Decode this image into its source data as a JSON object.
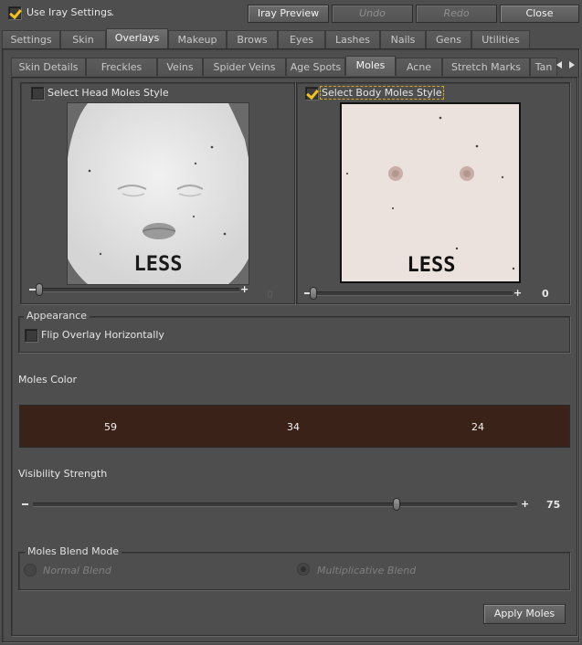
{
  "top_bar": {
    "use_iray_label": "Use Iray Settings",
    "ellipsis": "..",
    "iray_preview": "Iray Preview",
    "undo": "Undo",
    "redo": "Redo",
    "close": "Close"
  },
  "main_tabs": [
    "Settings",
    "Skin",
    "Overlays",
    "Makeup",
    "Brows",
    "Eyes",
    "Lashes",
    "Nails",
    "Gens",
    "Utilities"
  ],
  "sub_tabs": [
    "Skin Details",
    "Freckles",
    "Veins",
    "Spider Veins",
    "Age Spots",
    "Moles",
    "Acne",
    "Stretch Marks",
    "Tan"
  ],
  "head_moles": {
    "label": "Select Head Moles Style",
    "preview_text": "LESS",
    "slider_value": "0"
  },
  "body_moles": {
    "label": "Select Body Moles Style",
    "preview_text": "LESS",
    "slider_value": "0"
  },
  "appearance": {
    "title": "Appearance",
    "flip_label": "Flip Overlay Horizontally"
  },
  "moles_color": {
    "label": "Moles Color",
    "r": "59",
    "g": "34",
    "b": "24",
    "swatch": "#3b2218"
  },
  "visibility": {
    "label": "Visibility Strength",
    "value": "75",
    "fraction": 0.75
  },
  "blend_mode": {
    "title": "Moles Blend Mode",
    "normal": "Normal Blend",
    "multiplicative": "Multiplicative Blend"
  },
  "apply_button": "Apply Moles",
  "colors": {
    "accent": "#f2c21b",
    "background": "#4e4e4e"
  }
}
